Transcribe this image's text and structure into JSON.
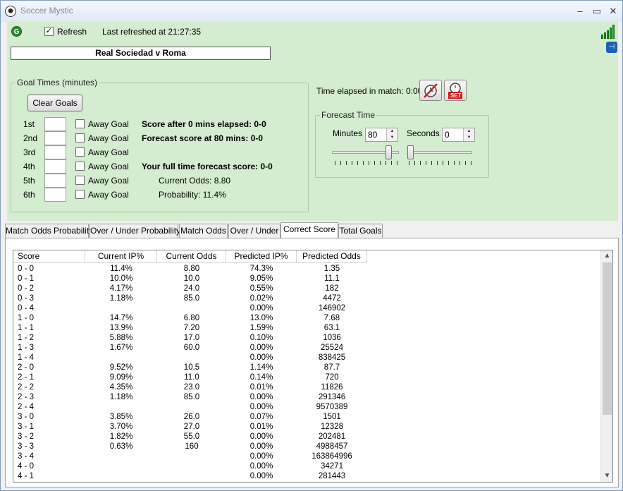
{
  "window": {
    "title": "Soccer Mystic"
  },
  "toolbar": {
    "refresh_label": "Refresh",
    "refresh_checked": "✓",
    "last_refreshed": "Last refreshed at 21:27:35"
  },
  "match": {
    "title": "Real Sociedad v Roma"
  },
  "goal_times": {
    "legend": "Goal Times (minutes)",
    "clear_label": "Clear Goals",
    "rows": [
      {
        "label": "1st",
        "away_label": "Away Goal"
      },
      {
        "label": "2nd",
        "away_label": "Away Goal"
      },
      {
        "label": "3rd",
        "away_label": "Away Goal"
      },
      {
        "label": "4th",
        "away_label": "Away Goal"
      },
      {
        "label": "5th",
        "away_label": "Away Goal"
      },
      {
        "label": "6th",
        "away_label": "Away Goal"
      }
    ],
    "score_after": "Score after 0 mins elapsed: 0-0",
    "forecast_score": "Forecast score at 80 mins: 0-0",
    "full_time_forecast": "Your full time forecast score: 0-0",
    "current_odds": "Current Odds: 8.80",
    "probability": "Probability: 11.4%"
  },
  "elapsed": {
    "label": "Time elapsed in match: 0:00",
    "set_label": "SET"
  },
  "forecast_time": {
    "legend": "Forecast Time",
    "minutes_label": "Minutes",
    "minutes_value": "80",
    "seconds_label": "Seconds",
    "seconds_value": "0",
    "minutes_slider_fraction": 0.889,
    "seconds_slider_fraction": 0.0
  },
  "tabs": [
    "Match Odds Probability",
    "Over / Under Probability",
    "Match Odds",
    "Over / Under",
    "Correct Score",
    "Total Goals"
  ],
  "active_tab": "Correct Score",
  "grid": {
    "columns": [
      "Score",
      "Current IP%",
      "Current Odds",
      "Predicted IP%",
      "Predicted Odds"
    ],
    "rows": [
      [
        "0 - 0",
        "11.4%",
        "8.80",
        "74.3%",
        "1.35"
      ],
      [
        "0 - 1",
        "10.0%",
        "10.0",
        "9.05%",
        "11.1"
      ],
      [
        "0 - 2",
        "4.17%",
        "24.0",
        "0.55%",
        "182"
      ],
      [
        "0 - 3",
        "1.18%",
        "85.0",
        "0.02%",
        "4472"
      ],
      [
        "0 - 4",
        "",
        "",
        "0.00%",
        "146902"
      ],
      [
        "1 - 0",
        "14.7%",
        "6.80",
        "13.0%",
        "7.68"
      ],
      [
        "1 - 1",
        "13.9%",
        "7.20",
        "1.59%",
        "63.1"
      ],
      [
        "1 - 2",
        "5.88%",
        "17.0",
        "0.10%",
        "1036"
      ],
      [
        "1 - 3",
        "1.67%",
        "60.0",
        "0.00%",
        "25524"
      ],
      [
        "1 - 4",
        "",
        "",
        "0.00%",
        "838425"
      ],
      [
        "2 - 0",
        "9.52%",
        "10.5",
        "1.14%",
        "87.7"
      ],
      [
        "2 - 1",
        "9.09%",
        "11.0",
        "0.14%",
        "720"
      ],
      [
        "2 - 2",
        "4.35%",
        "23.0",
        "0.01%",
        "11826"
      ],
      [
        "2 - 3",
        "1.18%",
        "85.0",
        "0.00%",
        "291346"
      ],
      [
        "2 - 4",
        "",
        "",
        "0.00%",
        "9570389"
      ],
      [
        "3 - 0",
        "3.85%",
        "26.0",
        "0.07%",
        "1501"
      ],
      [
        "3 - 1",
        "3.70%",
        "27.0",
        "0.01%",
        "12328"
      ],
      [
        "3 - 2",
        "1.82%",
        "55.0",
        "0.00%",
        "202481"
      ],
      [
        "3 - 3",
        "0.63%",
        "160",
        "0.00%",
        "4988457"
      ],
      [
        "3 - 4",
        "",
        "",
        "0.00%",
        "163864996"
      ],
      [
        "4 - 0",
        "",
        "",
        "0.00%",
        "34271"
      ],
      [
        "4 - 1",
        "",
        "",
        "0.00%",
        "281443"
      ]
    ]
  },
  "colors": {
    "panel_green": "#d4eccf",
    "signal_green": "#1f9a1f"
  }
}
